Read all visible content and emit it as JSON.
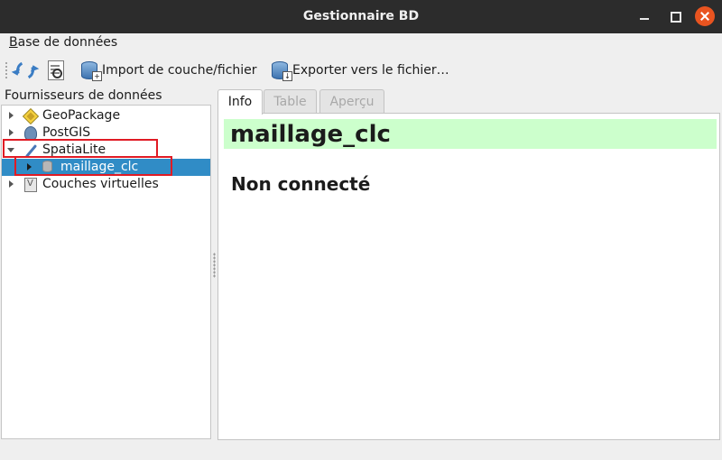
{
  "window": {
    "title": "Gestionnaire BD"
  },
  "menubar": {
    "items": [
      {
        "mnemonic": "B",
        "rest": "ase de données"
      }
    ]
  },
  "toolbar": {
    "refresh_icon": "refresh-icon",
    "sql_icon": "sql-window-icon",
    "import_label": "Import de couche/fichier",
    "export_label": "Exporter vers le fichier…"
  },
  "providers": {
    "title": "Fournisseurs de données",
    "items": [
      {
        "label": "GeoPackage",
        "icon": "geopackage-icon",
        "expanded": false
      },
      {
        "label": "PostGIS",
        "icon": "postgis-icon",
        "expanded": false
      },
      {
        "label": "SpatiaLite",
        "icon": "spatialite-icon",
        "expanded": true
      },
      {
        "label": "maillage_clc",
        "icon": "database-layer-icon",
        "selected": true,
        "child": true
      },
      {
        "label": "Couches virtuelles",
        "icon": "virtual-layers-icon",
        "expanded": false
      }
    ]
  },
  "tabs": [
    {
      "label": "Info",
      "active": true
    },
    {
      "label": "Table",
      "active": false
    },
    {
      "label": "Aperçu",
      "active": false
    }
  ],
  "info": {
    "layer_name": "maillage_clc",
    "status": "Non connecté",
    "header_color": "#ccffcc"
  },
  "colors": {
    "selection": "#308cc6",
    "highlight_box": "#e01b24",
    "titlebar": "#2c2c2c",
    "close_button": "#e95420"
  }
}
